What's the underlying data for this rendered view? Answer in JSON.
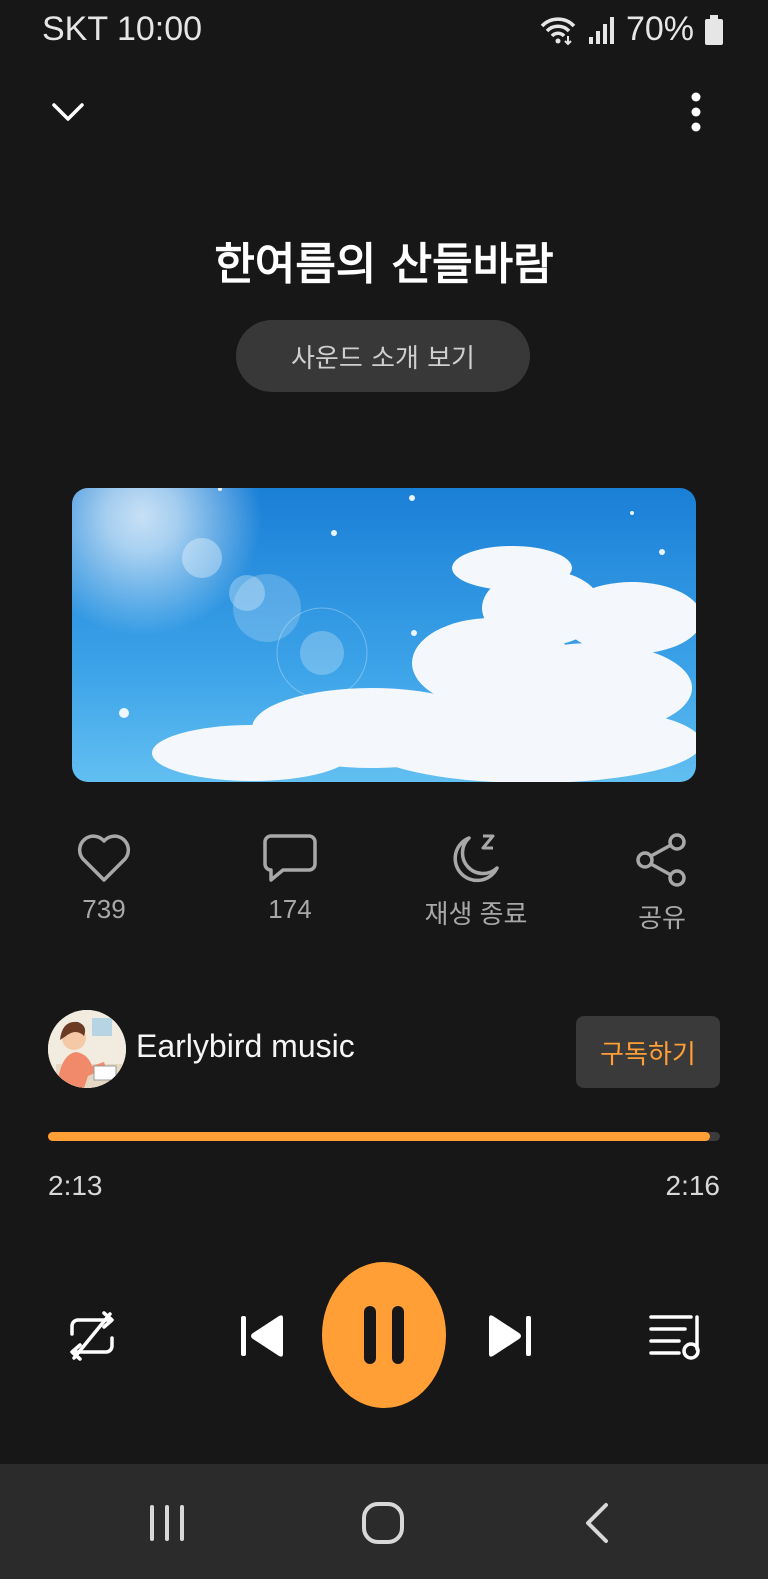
{
  "status_bar": {
    "carrier": "SKT",
    "time": "10:00",
    "battery": "70%",
    "icons": [
      "wifi-icon",
      "signal-icon",
      "battery-icon"
    ]
  },
  "header": {
    "collapse_icon": "chevron-down-icon",
    "more_icon": "more-vertical-icon"
  },
  "track": {
    "title": "한여름의 산들바람",
    "intro_button": "사운드 소개 보기"
  },
  "actions": {
    "like_count": "739",
    "comment_count": "174",
    "sleep_label": "재생 종료",
    "share_label": "공유"
  },
  "channel": {
    "name": "Earlybird music",
    "subscribe_label": "구독하기"
  },
  "playback": {
    "current_time": "2:13",
    "total_time": "2:16",
    "progress": 0.985
  },
  "colors": {
    "accent": "#ff9f35",
    "background": "#171717",
    "navbar": "#2b2b2b"
  },
  "controls": [
    "repeat-icon",
    "previous-icon",
    "pause-icon",
    "next-icon",
    "playlist-icon"
  ],
  "nav_bar": [
    "recent-apps-icon",
    "home-icon",
    "back-icon"
  ]
}
